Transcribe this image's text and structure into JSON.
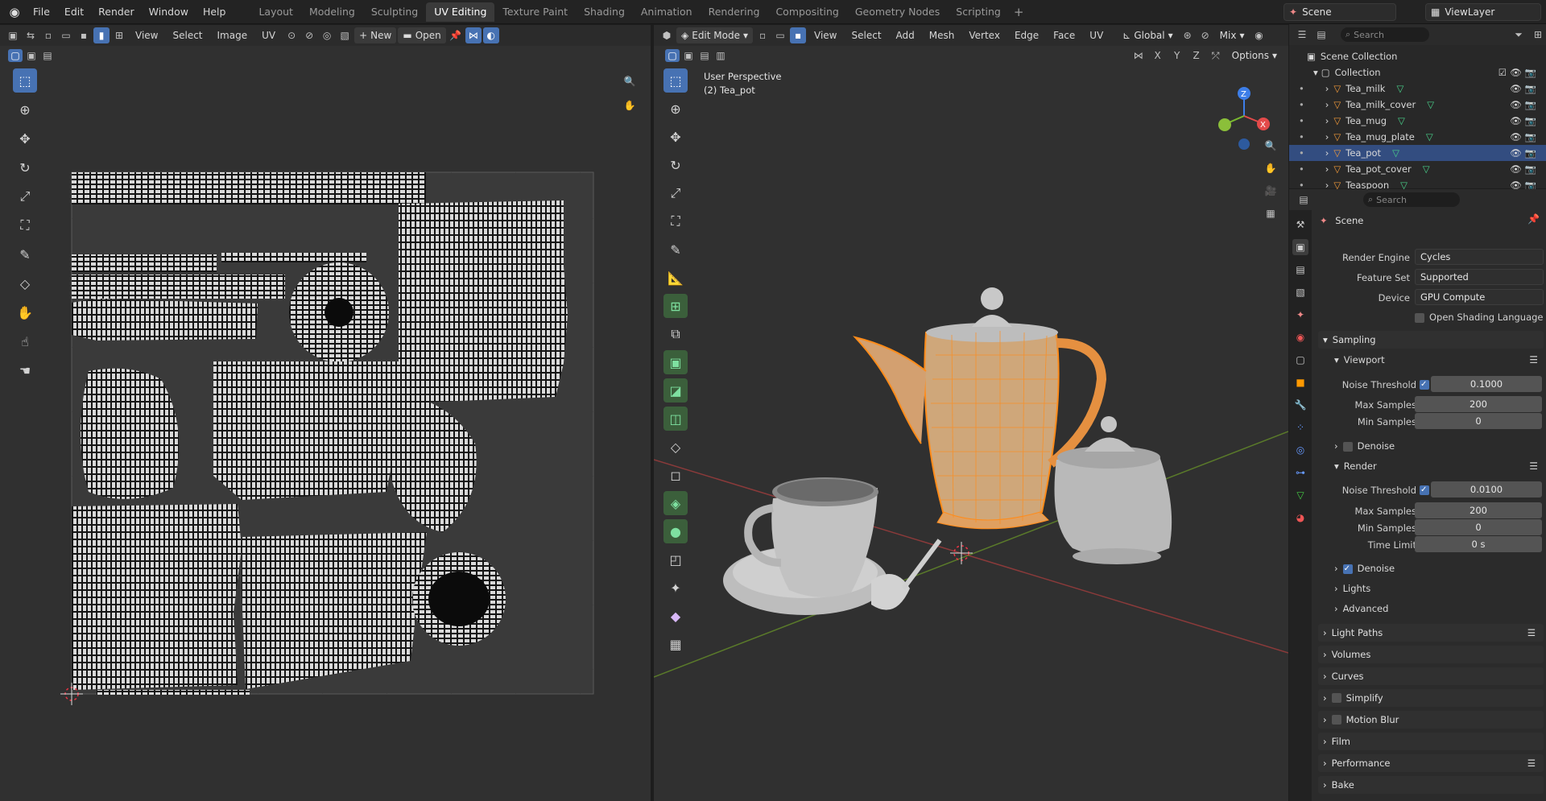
{
  "top_menu": [
    "File",
    "Edit",
    "Render",
    "Window",
    "Help"
  ],
  "workspaces": [
    "Layout",
    "Modeling",
    "Sculpting",
    "UV Editing",
    "Texture Paint",
    "Shading",
    "Animation",
    "Rendering",
    "Compositing",
    "Geometry Nodes",
    "Scripting"
  ],
  "active_workspace": "UV Editing",
  "scene_name": "Scene",
  "view_layer": "ViewLayer",
  "uv_editor": {
    "menus": [
      "View",
      "Select",
      "Image",
      "UV"
    ],
    "new_label": "New",
    "open_label": "Open"
  },
  "viewport": {
    "mode": "Edit Mode",
    "menus": [
      "View",
      "Select",
      "Add",
      "Mesh",
      "Vertex",
      "Edge",
      "Face",
      "UV"
    ],
    "transform": "Global",
    "shading": "Mix",
    "options_label": "Options",
    "overlay_line1": "User Perspective",
    "overlay_line2": "(2) Tea_pot",
    "axes": [
      "X",
      "Y",
      "Z"
    ],
    "gizmo_z": "Z",
    "gizmo_x": "X"
  },
  "outliner": {
    "search_placeholder": "Search",
    "root": "Scene Collection",
    "collection": "Collection",
    "objects": [
      "Tea_milk",
      "Tea_milk_cover",
      "Tea_mug",
      "Tea_mug_plate",
      "Tea_pot",
      "Tea_pot_cover",
      "Teaspoon"
    ],
    "selected": "Tea_pot"
  },
  "properties": {
    "search_placeholder": "Search",
    "context": "Scene",
    "render_engine_label": "Render Engine",
    "render_engine": "Cycles",
    "feature_set_label": "Feature Set",
    "feature_set": "Supported",
    "device_label": "Device",
    "device": "GPU Compute",
    "osl_label": "Open Shading Language",
    "sampling": "Sampling",
    "viewport": "Viewport",
    "noise_threshold_label": "Noise Threshold",
    "vp_noise": "0.1000",
    "max_samples_label": "Max Samples",
    "vp_max": "200",
    "min_samples_label": "Min Samples",
    "vp_min": "0",
    "denoise_label": "Denoise",
    "render": "Render",
    "r_noise": "0.0100",
    "r_max": "200",
    "r_min": "0",
    "time_limit_label": "Time Limit",
    "r_time": "0 s",
    "lights": "Lights",
    "advanced": "Advanced",
    "panels": [
      "Light Paths",
      "Volumes",
      "Curves",
      "Simplify",
      "Motion Blur",
      "Film",
      "Performance",
      "Bake"
    ]
  },
  "colors": {
    "accent": "#4772b3",
    "selection_orange": "#ff8c1a",
    "grid_bg": "#303030"
  }
}
